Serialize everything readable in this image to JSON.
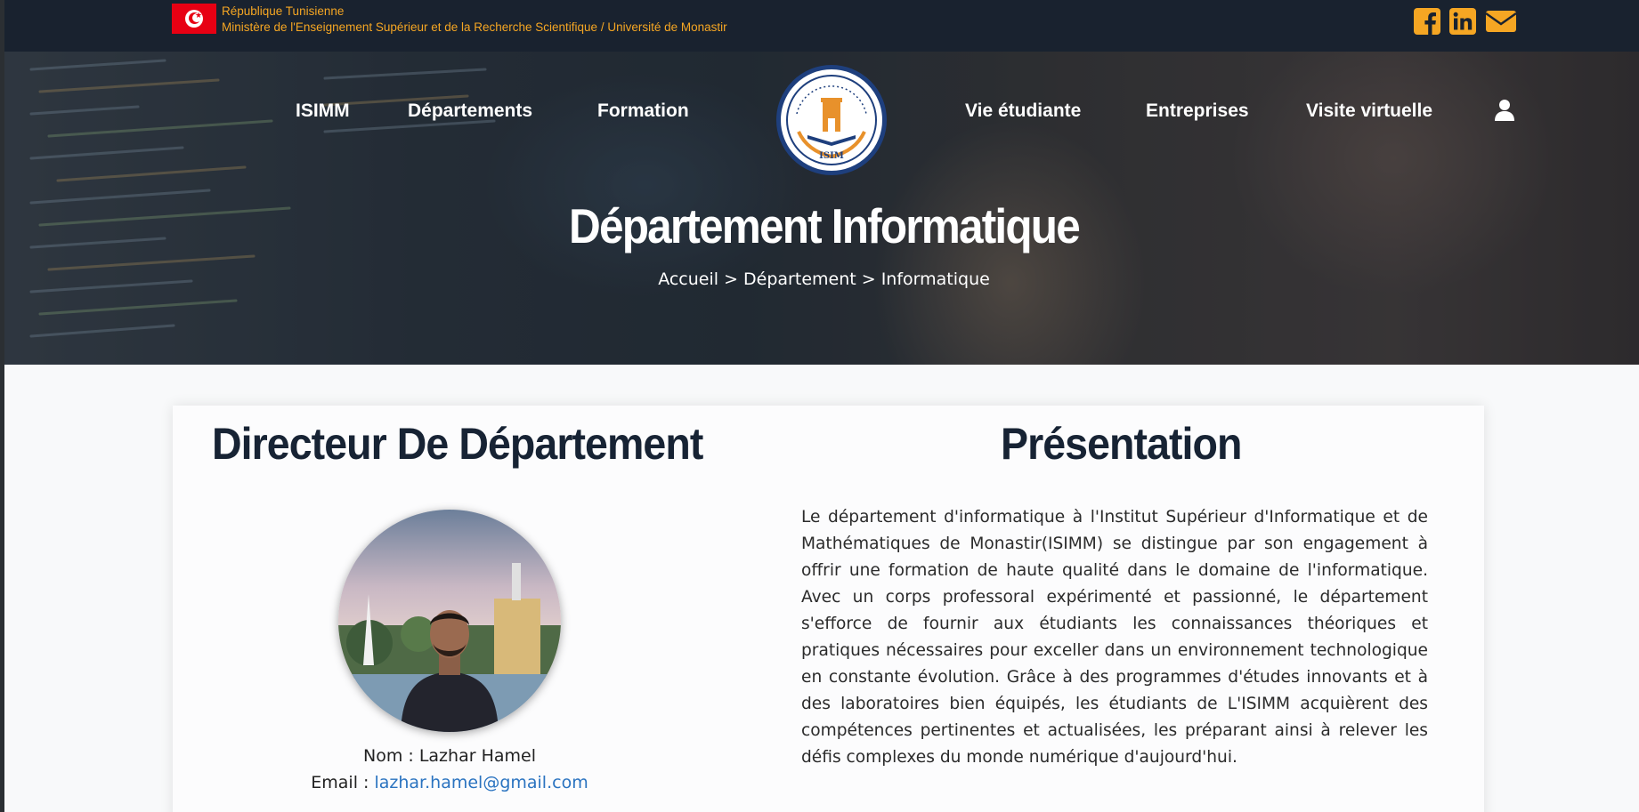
{
  "topbar": {
    "line1": "République Tunisienne",
    "line2": "Ministère de l'Enseignement Supérieur et de la Recherche Scientifique / Université de Monastir",
    "social_icons": [
      "facebook-icon",
      "linkedin-icon",
      "envelope-icon"
    ],
    "accent_color": "#f5a623",
    "background_color": "#19222f"
  },
  "nav": {
    "items": [
      "ISIMM",
      "Départements",
      "Formation",
      "Vie étudiante",
      "Entreprises",
      "Visite virtuelle"
    ],
    "logo_text": "ISIM",
    "user_icon": "user-icon"
  },
  "hero": {
    "title": "Département Informatique",
    "breadcrumb": "Accueil > Département > Informatique"
  },
  "director": {
    "title": "Directeur De Département",
    "name_label": "Nom : Lazhar Hamel",
    "email_prefix": "Email : ",
    "email": "lazhar.hamel@gmail.com"
  },
  "presentation": {
    "title": "Présentation",
    "text": "Le département d'informatique à l'Institut Supérieur d'Informatique et de Mathématiques de Monastir(ISIMM) se distingue par son engagement à offrir une formation de haute qualité dans le domaine de l'informatique. Avec un corps professoral expérimenté et passionné, le département s'efforce de fournir aux étudiants les connaissances théoriques et pratiques nécessaires pour exceller dans un environnement technologique en constante évolution. Grâce à des programmes d'études innovants et à des laboratoires bien équipés, les étudiants de L'ISIMM acquièrent des compétences pertinentes et actualisées, les préparant ainsi à relever les défis complexes du monde numérique d'aujourd'hui."
  },
  "colors": {
    "heading": "#172334",
    "link": "#2a73c0",
    "flag_red": "#e70013",
    "logo_ring": "#1e3f7d"
  }
}
